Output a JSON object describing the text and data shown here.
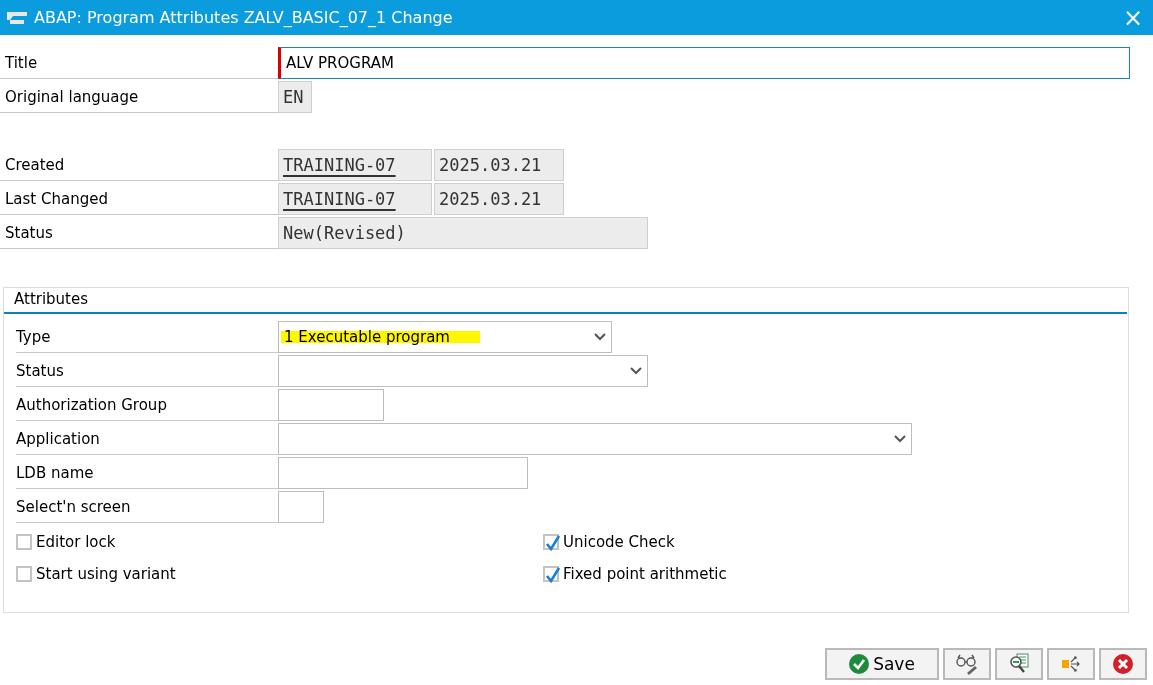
{
  "window": {
    "title": "ABAP: Program Attributes ZALV_BASIC_07_1 Change",
    "close": "×"
  },
  "header_fields": [
    {
      "label": "Title",
      "kind": "input",
      "focused": true,
      "values": [
        "ALV PROGRAM"
      ]
    },
    {
      "label": "Original language",
      "kind": "display",
      "values": [
        "EN"
      ]
    },
    {
      "kind": "spacer"
    },
    {
      "label": "Created",
      "kind": "display",
      "values": [
        "TRAINING-07",
        "2025.03.21"
      ],
      "link_first": true
    },
    {
      "label": "Last Changed",
      "kind": "display",
      "values": [
        "TRAINING-07",
        "2025.03.21"
      ],
      "link_first": true
    },
    {
      "label": "Status",
      "kind": "display",
      "values": [
        "New(Revised)"
      ]
    }
  ],
  "attributes": {
    "title": "Attributes",
    "fields": [
      {
        "label": "Type",
        "kind": "dropdown",
        "value": "1 Executable program",
        "highlighted": true
      },
      {
        "label": "Status",
        "kind": "dropdown"
      },
      {
        "label": "Authorization Group",
        "kind": "input"
      },
      {
        "label": "Application",
        "kind": "dropdown"
      },
      {
        "label": "LDB name",
        "kind": "input"
      },
      {
        "label": "Select'n screen",
        "kind": "input"
      }
    ],
    "checkboxes": [
      {
        "label": "Editor lock",
        "checked": false
      },
      {
        "label": "Unicode Check",
        "checked": true
      },
      {
        "label": "Start using variant",
        "checked": false
      },
      {
        "label": "Fixed point arithmetic",
        "checked": true
      }
    ]
  },
  "buttons": [
    {
      "kind": "save",
      "label": "Save"
    },
    {
      "kind": "display-change"
    },
    {
      "kind": "check"
    },
    {
      "kind": "where-used"
    },
    {
      "kind": "cancel"
    }
  ]
}
